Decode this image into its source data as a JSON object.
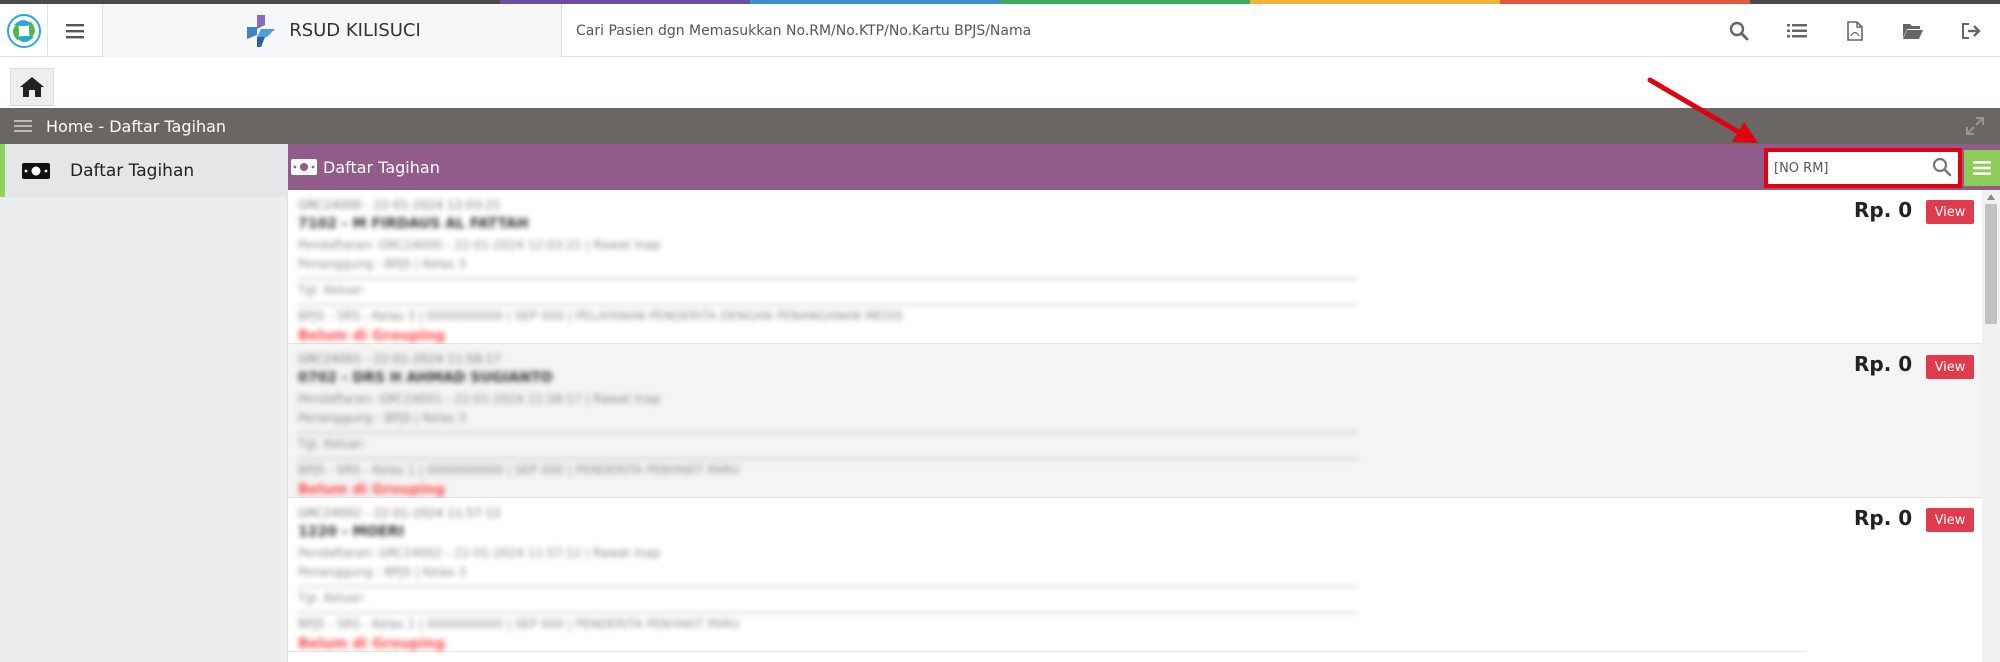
{
  "colors": {
    "accent_purple": "#915b8a",
    "breadcrumb_bg": "#6b6564",
    "highlight_red": "#e0000f",
    "view_button": "#e03b4c",
    "grid_button": "#8fcb5b",
    "sidebar_active": "#8fd35a"
  },
  "header": {
    "logo_icon": "app-logo-icon",
    "menu_icon": "hamburger-icon",
    "hospital_name": "RSUD KILISUCI",
    "search_text": "Cari Pasien dgn Memasukkan No.RM/No.KTP/No.Kartu BPJS/Nama",
    "icons": [
      "search-icon",
      "list-icon",
      "pdf-file-icon",
      "folder-open-icon",
      "logout-icon"
    ]
  },
  "breadcrumb": {
    "text": "Home - Daftar Tagihan"
  },
  "sidebar": {
    "items": [
      {
        "label": "Daftar Tagihan",
        "icon": "money-icon",
        "active": true
      }
    ]
  },
  "panel": {
    "title": "Daftar Tagihan",
    "rm_input_value": "[NO RM]"
  },
  "rows": [
    {
      "line1": "GRC24000 - 22-01-2024 12:03:21",
      "line2": "7102 - M FIRDAUS AL FATTAH",
      "line3": "Pendaftaran: GRC24000 - 22-01-2024 12:03:21 | Rawat Inap",
      "line4": "Penanggung : BPJS | Kelas 3",
      "line5": "Tgl. Keluar:",
      "line6": "BPJS - SRS - Kelas 3 | 0000000000 | SEP 000 | PELAYANAN PENDERITA DENGAN PENANGANAN MEDIS",
      "warn": "Belum di Grouping",
      "price": "Rp. 0",
      "view": "View"
    },
    {
      "line1": "GRC24001 - 22-01-2024 11:58:17",
      "line2": "0702 - DRS H AHMAD SUGIANTO",
      "line3": "Pendaftaran: GRC24001 - 22-01-2024 11:58:17 | Rawat Inap",
      "line4": "Penanggung : BPJS | Kelas 3",
      "line5": "Tgl. Keluar:",
      "line6": "BPJS - SRS - Kelas 1 | 0000000000 | SEP 000 | PENDERITA PENYAKIT PARU",
      "warn": "Belum di Grouping",
      "price": "Rp. 0",
      "view": "View"
    },
    {
      "line1": "GRC24002 - 22-01-2024 11:57:12",
      "line2": "1220 - MOERI",
      "line3": "Pendaftaran: GRC24002 - 22-01-2024 11:57:12 | Rawat Inap",
      "line4": "Penanggung : BPJS | Kelas 3",
      "line5": "Tgl. Keluar:",
      "line6": "BPJS - SRS - Kelas 1 | 0000000000 | SEP 000 | PENDERITA PENYAKIT PARU",
      "warn": "Belum di Grouping",
      "price": "Rp. 0",
      "view": "View"
    }
  ]
}
